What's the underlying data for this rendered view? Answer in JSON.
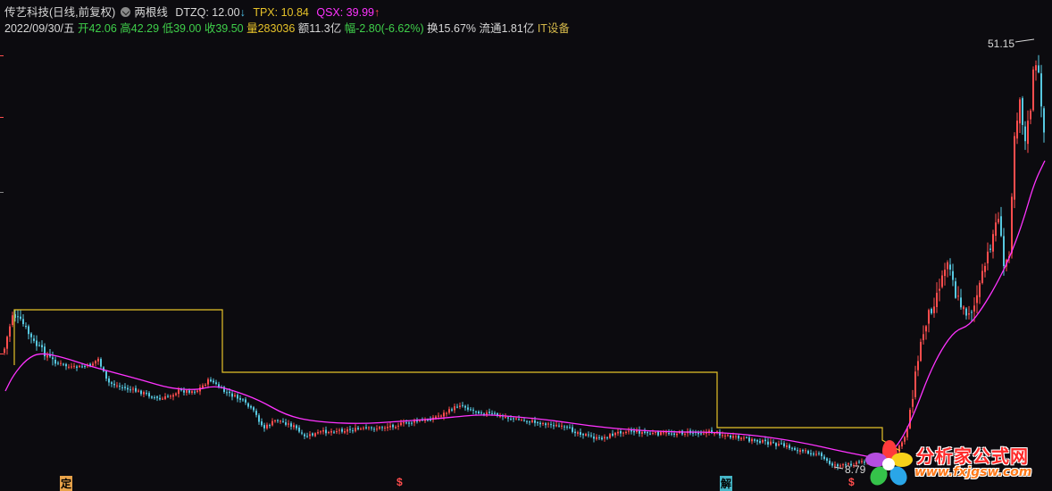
{
  "header": {
    "stock_name": "传艺科技",
    "period": "(日线,前复权)",
    "indicator_name": "两根线",
    "dtzq_label": "DTZQ: 12.00",
    "dtzq_arrow": "↓",
    "tpx_label": "TPX: 10.84",
    "qsx_label": "QSX: 39.99",
    "qsx_arrow": "↑",
    "date": "2022/09/30/五",
    "open": "开42.06",
    "high": "高42.29",
    "low": "低39.00",
    "close": "收39.50",
    "volume": "量283036",
    "amount": "额11.3亿",
    "change": "幅-2.80(-6.62%)",
    "turnover": "换15.67%",
    "float": "流通1.81亿",
    "sector": "IT设备"
  },
  "annotations": {
    "high_price": "51.15",
    "low_price": "8.79"
  },
  "markers": {
    "m1": "定",
    "m2": "$",
    "m3": "解",
    "m4": "$"
  },
  "watermark": {
    "title": "分析家公式网",
    "url": "www.fxjgsw.com"
  },
  "colors": {
    "background": "#0c0b0f",
    "up_candle": "#ff4d4d",
    "down_candle": "#57c8e0",
    "step_line": "#e6c229",
    "ma_line": "#ff33ff"
  },
  "icons": {
    "settings": "settings-dot-icon",
    "dtzq_arrow": "down-arrow-icon",
    "qsx_arrow": "up-arrow-icon"
  }
}
